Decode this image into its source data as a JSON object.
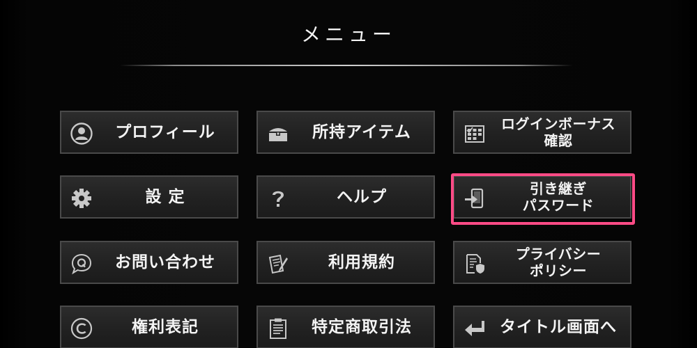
{
  "header": {
    "title": "メニュー"
  },
  "menu": {
    "items": [
      {
        "id": "profile",
        "lines": [
          "プロフィール"
        ],
        "icon": "user-circle-icon"
      },
      {
        "id": "items",
        "lines": [
          "所持アイテム"
        ],
        "icon": "treasure-chest-icon"
      },
      {
        "id": "login-bonus",
        "lines": [
          "ログインボーナス",
          "確認"
        ],
        "icon": "calendar-icon"
      },
      {
        "id": "settings",
        "lines": [
          "設 定"
        ],
        "icon": "gear-icon"
      },
      {
        "id": "help",
        "lines": [
          "ヘルプ"
        ],
        "icon": "question-mark-icon"
      },
      {
        "id": "transfer-password",
        "lines": [
          "引き継ぎ",
          "パスワード"
        ],
        "icon": "phone-transfer-icon"
      },
      {
        "id": "contact",
        "lines": [
          "お問い合わせ"
        ],
        "icon": "q-bubble-icon"
      },
      {
        "id": "terms",
        "lines": [
          "利用規約"
        ],
        "icon": "document-pen-icon"
      },
      {
        "id": "privacy",
        "lines": [
          "プライバシー",
          "ポリシー"
        ],
        "icon": "document-shield-icon"
      },
      {
        "id": "copyright",
        "lines": [
          "権利表記"
        ],
        "icon": "copyright-icon"
      },
      {
        "id": "commercial-law",
        "lines": [
          "特定商取引法"
        ],
        "icon": "clipboard-icon"
      },
      {
        "id": "to-title",
        "lines": [
          "タイトル画面へ"
        ],
        "icon": "return-arrow-icon"
      }
    ]
  },
  "colors": {
    "highlight": "#ff4b86",
    "button_border": "#4a4a4a",
    "icon": "#c8c8c8",
    "text": "#f4f4f4"
  }
}
